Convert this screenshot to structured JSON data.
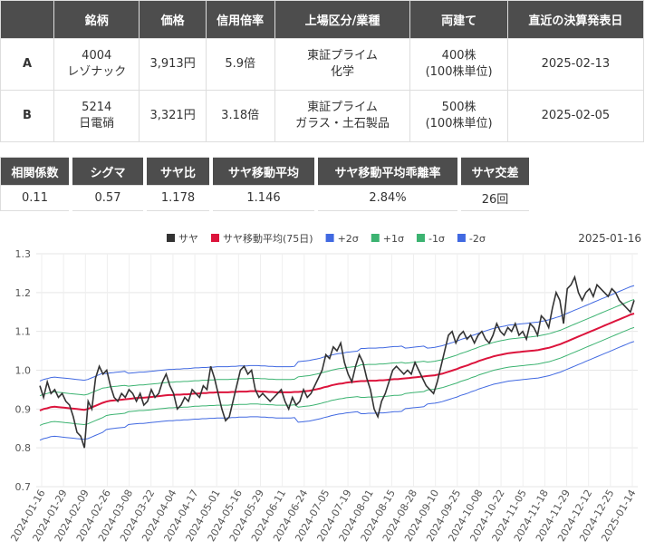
{
  "table1": {
    "headers": [
      "",
      "銘柄",
      "価格",
      "信用倍率",
      "上場区分/業種",
      "両建て",
      "直近の決算発表日"
    ],
    "rows": [
      {
        "label": "A",
        "code": "4004",
        "name": "レゾナック",
        "price": "3,913円",
        "margin": "5.9倍",
        "market": "東証プライム",
        "sector": "化学",
        "hedge": "400株",
        "unit": "(100株単位)",
        "date": "2025-02-13"
      },
      {
        "label": "B",
        "code": "5214",
        "name": "日電硝",
        "price": "3,321円",
        "margin": "3.18倍",
        "market": "東証プライム",
        "sector": "ガラス・土石製品",
        "hedge": "500株",
        "unit": "(100株単位)",
        "date": "2025-02-05"
      }
    ]
  },
  "table2": {
    "headers": [
      "相関係数",
      "シグマ",
      "サヤ比",
      "サヤ移動平均",
      "サヤ移動平均乖離率",
      "サヤ交差"
    ],
    "values": [
      "0.11",
      "0.57",
      "1.178",
      "1.146",
      "2.84%",
      "26回"
    ]
  },
  "chart_data": {
    "type": "line",
    "date_label": "2025-01-16",
    "ylim": [
      0.7,
      1.3
    ],
    "yticks": [
      "0.7",
      "0.8",
      "0.9",
      "1.0",
      "1.1",
      "1.2",
      "1.3"
    ],
    "xticks": [
      "2024-01-16",
      "2024-01-29",
      "2024-02-09",
      "2024-02-26",
      "2024-03-08",
      "2024-03-22",
      "2024-04-04",
      "2024-04-17",
      "2024-05-01",
      "2024-05-16",
      "2024-05-29",
      "2024-06-11",
      "2024-06-24",
      "2024-07-05",
      "2024-07-19",
      "2024-08-01",
      "2024-08-15",
      "2024-08-28",
      "2024-09-10",
      "2024-09-25",
      "2024-10-08",
      "2024-10-22",
      "2024-11-05",
      "2024-11-18",
      "2024-11-29",
      "2024-12-12",
      "2024-12-25",
      "2025-01-14"
    ],
    "legend": [
      {
        "name": "サヤ",
        "color": "#333333"
      },
      {
        "name": "サヤ移動平均(75日)",
        "color": "#dc143c"
      },
      {
        "name": "+2σ",
        "color": "#4169e1"
      },
      {
        "name": "+1σ",
        "color": "#3cb371"
      },
      {
        "name": "-1σ",
        "color": "#3cb371"
      },
      {
        "name": "-2σ",
        "color": "#4169e1"
      }
    ],
    "series": [
      {
        "name": "サヤ",
        "values": [
          0.96,
          0.93,
          0.97,
          0.94,
          0.95,
          0.93,
          0.94,
          0.92,
          0.91,
          0.88,
          0.84,
          0.83,
          0.8,
          0.92,
          0.9,
          0.98,
          1.01,
          0.99,
          1.0,
          0.96,
          0.93,
          0.92,
          0.94,
          0.93,
          0.95,
          0.94,
          0.92,
          0.94,
          0.91,
          0.92,
          0.95,
          0.93,
          0.94,
          0.97,
          0.99,
          0.96,
          0.94,
          0.9,
          0.91,
          0.93,
          0.92,
          0.95,
          0.94,
          0.93,
          0.96,
          0.95,
          1.01,
          0.98,
          0.94,
          0.9,
          0.87,
          0.88,
          0.92,
          0.96,
          1.0,
          1.01,
          0.99,
          1.0,
          0.95,
          0.93,
          0.94,
          0.93,
          0.92,
          0.93,
          0.94,
          0.95,
          0.92,
          0.9,
          0.93,
          0.91,
          0.92,
          0.95,
          0.93,
          0.94,
          0.96,
          0.98,
          1.0,
          1.04,
          1.03,
          1.06,
          1.05,
          1.07,
          1.02,
          0.99,
          0.97,
          1.01,
          1.04,
          1.02,
          0.98,
          0.95,
          0.9,
          0.88,
          0.92,
          0.94,
          0.97,
          1.0,
          1.01,
          1.0,
          0.99,
          1.0,
          0.99,
          1.02,
          1.0,
          0.98,
          0.96,
          0.95,
          0.94,
          0.97,
          1.01,
          1.05,
          1.09,
          1.1,
          1.07,
          1.09,
          1.1,
          1.08,
          1.09,
          1.07,
          1.09,
          1.1,
          1.08,
          1.07,
          1.09,
          1.12,
          1.1,
          1.09,
          1.11,
          1.1,
          1.12,
          1.09,
          1.1,
          1.08,
          1.12,
          1.11,
          1.09,
          1.14,
          1.13,
          1.11,
          1.16,
          1.2,
          1.18,
          1.12,
          1.21,
          1.22,
          1.24,
          1.2,
          1.18,
          1.2,
          1.21,
          1.19,
          1.22,
          1.21,
          1.2,
          1.19,
          1.21,
          1.2,
          1.18,
          1.17,
          1.16,
          1.15,
          1.18
        ]
      },
      {
        "name": "サヤ移動平均(75日)",
        "values": [
          0.896,
          0.9,
          0.902,
          0.905,
          0.906,
          0.905,
          0.904,
          0.903,
          0.902,
          0.901,
          0.9,
          0.899,
          0.898,
          0.9,
          0.904,
          0.908,
          0.912,
          0.916,
          0.919,
          0.921,
          0.922,
          0.923,
          0.924,
          0.925,
          0.926,
          0.927,
          0.928,
          0.929,
          0.929,
          0.93,
          0.931,
          0.932,
          0.933,
          0.934,
          0.935,
          0.936,
          0.936,
          0.937,
          0.937,
          0.938,
          0.938,
          0.939,
          0.94,
          0.94,
          0.941,
          0.941,
          0.942,
          0.942,
          0.943,
          0.943,
          0.943,
          0.943,
          0.944,
          0.944,
          0.945,
          0.945,
          0.945,
          0.946,
          0.946,
          0.946,
          0.945,
          0.945,
          0.944,
          0.944,
          0.943,
          0.943,
          0.943,
          0.943,
          0.943,
          0.944,
          0.944,
          0.945,
          0.946,
          0.947,
          0.949,
          0.951,
          0.953,
          0.956,
          0.958,
          0.961,
          0.963,
          0.965,
          0.966,
          0.968,
          0.969,
          0.97,
          0.971,
          0.972,
          0.972,
          0.973,
          0.973,
          0.973,
          0.974,
          0.974,
          0.975,
          0.976,
          0.977,
          0.977,
          0.978,
          0.979,
          0.98,
          0.981,
          0.982,
          0.983,
          0.984,
          0.985,
          0.986,
          0.987,
          0.989,
          0.991,
          0.994,
          0.997,
          1.0,
          1.003,
          1.007,
          1.01,
          1.013,
          1.017,
          1.02,
          1.024,
          1.027,
          1.03,
          1.033,
          1.036,
          1.038,
          1.04,
          1.042,
          1.044,
          1.045,
          1.046,
          1.047,
          1.048,
          1.049,
          1.05,
          1.051,
          1.052,
          1.054,
          1.056,
          1.058,
          1.061,
          1.064,
          1.067,
          1.071,
          1.075,
          1.079,
          1.083,
          1.087,
          1.091,
          1.095,
          1.099,
          1.103,
          1.107,
          1.111,
          1.115,
          1.119,
          1.123,
          1.127,
          1.131,
          1.135,
          1.139,
          1.143,
          1.146
        ]
      }
    ],
    "bands": {
      "sigma_fraction_of_range": [
        0.0635,
        0.0635,
        0.0635,
        0.06,
        0.055,
        0.055,
        0.055,
        0.055,
        0.055,
        0.055,
        0.055,
        0.055,
        0.065,
        0.065,
        0.065,
        0.07,
        0.07,
        0.065,
        0.06,
        0.06,
        0.06,
        0.06,
        0.06,
        0.06,
        0.06,
        0.06,
        0.06,
        0.06
      ]
    }
  }
}
